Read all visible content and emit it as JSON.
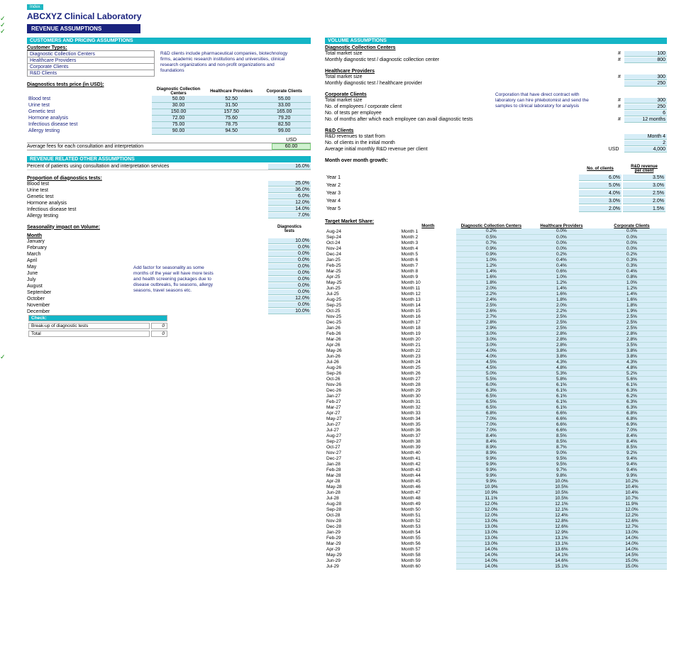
{
  "indexLabel": "Index",
  "title": "ABCXYZ Clinical Laboratory",
  "sectionTitle": "REVENUE ASSUMPTIONS",
  "left": {
    "custPricingTitle": "CUSTOMERS AND PRICING ASSUMPTIONS",
    "customerTypesLabel": "Customer Types:",
    "customerTypes": [
      "Diagnostic Collection Centers",
      "Healthcare Providers",
      "Corporate Clients",
      "R&D Clients"
    ],
    "rdNote": "R&D clients include pharmaceutical companies, biotechnology firms, academic research institutions and universities, clinical research organizations and non-profit organizations and foundations",
    "diagPriceLabel": "Diagnostics tests price (in USD):",
    "priceCols": [
      "Diagnostic Collection Centers",
      "Healthcare Providers",
      "Corporate Clients"
    ],
    "priceRows": [
      {
        "n": "Blood test",
        "v": [
          "50.00",
          "52.50",
          "55.00"
        ]
      },
      {
        "n": "Urine test",
        "v": [
          "30.00",
          "31.50",
          "33.00"
        ]
      },
      {
        "n": "Genetic test",
        "v": [
          "150.00",
          "157.50",
          "165.00"
        ]
      },
      {
        "n": "Hormone analysis",
        "v": [
          "72.00",
          "75.60",
          "79.20"
        ]
      },
      {
        "n": "Infectious disease test",
        "v": [
          "75.00",
          "78.75",
          "82.50"
        ]
      },
      {
        "n": "Allergy testing",
        "v": [
          "90.00",
          "94.50",
          "99.00"
        ]
      }
    ],
    "usdLabel": "USD",
    "avgFeesLabel": "Average fees for each consultation and interpretation",
    "avgFees": "60.00",
    "revOtherTitle": "REVENUE RELATED OTHER ASSUMPTIONS",
    "pctConsultLabel": "Percent of patients using consultation and interpretation services",
    "pctConsult": "16.0%",
    "propLabel": "Proportion of diagnostics tests:",
    "propRows": [
      {
        "n": "Blood test",
        "v": "25.0%"
      },
      {
        "n": "Urine test",
        "v": "36.0%"
      },
      {
        "n": "Genetic test",
        "v": "6.0%"
      },
      {
        "n": "Hormone analysis",
        "v": "12.0%"
      },
      {
        "n": "Infectious disease test",
        "v": "14.0%"
      },
      {
        "n": "Allergy testing",
        "v": "7.0%"
      }
    ],
    "seasonLabel": "Seasonality impact on Volume:",
    "seasonMonthHdr": "Month",
    "seasonTestsHdr": "Diagnostics\ntests",
    "seasonNote": "Add factor for seasonality as some months of the year will have more tests and health screening packages due to disease outbreaks, flu seasons, allergy seasons, travel seasons etc.",
    "seasonRows": [
      {
        "m": "January",
        "v": "10.0%"
      },
      {
        "m": "February",
        "v": "0.0%"
      },
      {
        "m": "March",
        "v": "0.0%"
      },
      {
        "m": "April",
        "v": "0.0%"
      },
      {
        "m": "May",
        "v": "0.0%"
      },
      {
        "m": "June",
        "v": "0.0%"
      },
      {
        "m": "July",
        "v": "0.0%"
      },
      {
        "m": "August",
        "v": "0.0%"
      },
      {
        "m": "September",
        "v": "0.0%"
      },
      {
        "m": "October",
        "v": "12.0%"
      },
      {
        "m": "November",
        "v": "0.0%"
      },
      {
        "m": "December",
        "v": "10.0%"
      }
    ],
    "checkTitle": "Check:",
    "checkRow1": "Break-up of diagnostic tests",
    "checkRow1v": "0",
    "checkRow2": "Total",
    "checkRow2v": "0"
  },
  "right": {
    "volTitle": "VOLUME ASSUMPTIONS",
    "dcc": {
      "title": "Diagnostic Collection Centers",
      "r1": "Total market size",
      "v1": "100",
      "r2": "Monthly diagnostic test / diagnostic collection center",
      "v2": "800"
    },
    "hp": {
      "title": "Healthcare Providers",
      "r1": "Total market size",
      "v1": "300",
      "r2": "Monthly diagnostic test / healthcare provider",
      "v2": "250"
    },
    "cc": {
      "title": "Corporate Clients",
      "note": "Corporation that have direct contract with laboratory can hire phlebotomist and send the samples to clinical laboratory for analysis",
      "r1": "Total market size",
      "v1": "300",
      "r2": "No. of employees / corporate client",
      "v2": "250",
      "r3": "No. of tests per employee",
      "v3": "6",
      "r4": "No. of months after which each employee can avail diagnostic tests",
      "v4": "12 months"
    },
    "rd": {
      "title": "R&D Clients",
      "r1": "R&D revenues to start from",
      "v1": "Month 4",
      "r2": "No. of clients in the initial month",
      "v2": "2",
      "r3": "Average initial monthly R&D revenue per client",
      "u3": "USD",
      "v3": "4,000"
    },
    "momTitle": "Month over month growth:",
    "momCol1": "No. of clients",
    "momCol2": "R&D revenue\nper client",
    "momRows": [
      {
        "y": "Year 1",
        "a": "6.0%",
        "b": "3.5%"
      },
      {
        "y": "Year 2",
        "a": "5.0%",
        "b": "3.0%"
      },
      {
        "y": "Year 3",
        "a": "4.0%",
        "b": "2.5%"
      },
      {
        "y": "Year 4",
        "a": "3.0%",
        "b": "2.0%"
      },
      {
        "y": "Year 5",
        "a": "2.0%",
        "b": "1.5%"
      }
    ],
    "tmsTitle": "Target Market Share:",
    "tmsMonthHdr": "Month",
    "tmsCols": [
      "Diagnostic Collection Centers",
      "Healthcare Providers",
      "Corporate Clients"
    ],
    "tmsRows": [
      {
        "d": "Aug-24",
        "m": "Month 1",
        "v": [
          "0.2%",
          "0.0%",
          "0.0%"
        ]
      },
      {
        "d": "Sep-24",
        "m": "Month 2",
        "v": [
          "0.5%",
          "0.0%",
          "0.0%"
        ]
      },
      {
        "d": "Oct-24",
        "m": "Month 3",
        "v": [
          "0.7%",
          "0.0%",
          "0.0%"
        ]
      },
      {
        "d": "Nov-24",
        "m": "Month 4",
        "v": [
          "0.9%",
          "0.0%",
          "0.0%"
        ]
      },
      {
        "d": "Dec-24",
        "m": "Month 5",
        "v": [
          "0.9%",
          "0.2%",
          "0.2%"
        ]
      },
      {
        "d": "Jan-25",
        "m": "Month 6",
        "v": [
          "1.0%",
          "0.4%",
          "0.3%"
        ]
      },
      {
        "d": "Feb-25",
        "m": "Month 7",
        "v": [
          "1.2%",
          "0.4%",
          "0.3%"
        ]
      },
      {
        "d": "Mar-25",
        "m": "Month 8",
        "v": [
          "1.4%",
          "0.6%",
          "0.4%"
        ]
      },
      {
        "d": "Apr-25",
        "m": "Month 9",
        "v": [
          "1.6%",
          "1.0%",
          "0.8%"
        ]
      },
      {
        "d": "May-25",
        "m": "Month 10",
        "v": [
          "1.8%",
          "1.2%",
          "1.0%"
        ]
      },
      {
        "d": "Jun-25",
        "m": "Month 11",
        "v": [
          "2.0%",
          "1.4%",
          "1.2%"
        ]
      },
      {
        "d": "Jul-25",
        "m": "Month 12",
        "v": [
          "2.2%",
          "1.6%",
          "1.4%"
        ]
      },
      {
        "d": "Aug-25",
        "m": "Month 13",
        "v": [
          "2.4%",
          "1.8%",
          "1.6%"
        ]
      },
      {
        "d": "Sep-25",
        "m": "Month 14",
        "v": [
          "2.5%",
          "2.0%",
          "1.8%"
        ]
      },
      {
        "d": "Oct-25",
        "m": "Month 15",
        "v": [
          "2.6%",
          "2.2%",
          "1.9%"
        ]
      },
      {
        "d": "Nov-25",
        "m": "Month 16",
        "v": [
          "2.7%",
          "2.5%",
          "2.5%"
        ]
      },
      {
        "d": "Dec-25",
        "m": "Month 17",
        "v": [
          "2.8%",
          "2.5%",
          "2.5%"
        ]
      },
      {
        "d": "Jan-26",
        "m": "Month 18",
        "v": [
          "2.9%",
          "2.5%",
          "2.5%"
        ]
      },
      {
        "d": "Feb-26",
        "m": "Month 19",
        "v": [
          "3.0%",
          "2.8%",
          "2.8%"
        ]
      },
      {
        "d": "Mar-26",
        "m": "Month 20",
        "v": [
          "3.0%",
          "2.8%",
          "2.8%"
        ]
      },
      {
        "d": "Apr-26",
        "m": "Month 21",
        "v": [
          "3.0%",
          "2.8%",
          "3.5%"
        ]
      },
      {
        "d": "May-26",
        "m": "Month 22",
        "v": [
          "4.0%",
          "3.8%",
          "3.8%"
        ]
      },
      {
        "d": "Jun-26",
        "m": "Month 23",
        "v": [
          "4.0%",
          "3.8%",
          "3.8%"
        ]
      },
      {
        "d": "Jul-26",
        "m": "Month 24",
        "v": [
          "4.5%",
          "4.3%",
          "4.3%"
        ]
      },
      {
        "d": "Aug-26",
        "m": "Month 25",
        "v": [
          "4.5%",
          "4.8%",
          "4.8%"
        ]
      },
      {
        "d": "Sep-26",
        "m": "Month 26",
        "v": [
          "5.0%",
          "5.3%",
          "5.2%"
        ]
      },
      {
        "d": "Oct-26",
        "m": "Month 27",
        "v": [
          "5.5%",
          "5.8%",
          "5.6%"
        ]
      },
      {
        "d": "Nov-26",
        "m": "Month 28",
        "v": [
          "6.0%",
          "6.1%",
          "6.1%"
        ]
      },
      {
        "d": "Dec-26",
        "m": "Month 29",
        "v": [
          "6.3%",
          "6.1%",
          "6.3%"
        ]
      },
      {
        "d": "Jan-27",
        "m": "Month 30",
        "v": [
          "6.5%",
          "6.1%",
          "6.2%"
        ]
      },
      {
        "d": "Feb-27",
        "m": "Month 31",
        "v": [
          "6.5%",
          "6.1%",
          "6.3%"
        ]
      },
      {
        "d": "Mar-27",
        "m": "Month 32",
        "v": [
          "6.5%",
          "6.1%",
          "6.3%"
        ]
      },
      {
        "d": "Apr-27",
        "m": "Month 33",
        "v": [
          "6.8%",
          "6.6%",
          "6.8%"
        ]
      },
      {
        "d": "May-27",
        "m": "Month 34",
        "v": [
          "7.0%",
          "6.6%",
          "6.8%"
        ]
      },
      {
        "d": "Jun-27",
        "m": "Month 35",
        "v": [
          "7.0%",
          "6.6%",
          "6.9%"
        ]
      },
      {
        "d": "Jul-27",
        "m": "Month 36",
        "v": [
          "7.0%",
          "6.6%",
          "7.0%"
        ]
      },
      {
        "d": "Aug-27",
        "m": "Month 37",
        "v": [
          "8.4%",
          "8.5%",
          "8.4%"
        ]
      },
      {
        "d": "Sep-27",
        "m": "Month 38",
        "v": [
          "8.4%",
          "8.5%",
          "8.4%"
        ]
      },
      {
        "d": "Oct-27",
        "m": "Month 39",
        "v": [
          "8.9%",
          "8.7%",
          "8.5%"
        ]
      },
      {
        "d": "Nov-27",
        "m": "Month 40",
        "v": [
          "8.9%",
          "9.0%",
          "9.2%"
        ]
      },
      {
        "d": "Dec-27",
        "m": "Month 41",
        "v": [
          "9.9%",
          "9.5%",
          "9.4%"
        ]
      },
      {
        "d": "Jan-28",
        "m": "Month 42",
        "v": [
          "9.9%",
          "9.5%",
          "9.4%"
        ]
      },
      {
        "d": "Feb-28",
        "m": "Month 43",
        "v": [
          "9.9%",
          "9.7%",
          "9.4%"
        ]
      },
      {
        "d": "Mar-28",
        "m": "Month 44",
        "v": [
          "9.9%",
          "9.8%",
          "9.9%"
        ]
      },
      {
        "d": "Apr-28",
        "m": "Month 45",
        "v": [
          "9.9%",
          "10.0%",
          "10.2%"
        ]
      },
      {
        "d": "May-28",
        "m": "Month 46",
        "v": [
          "10.9%",
          "10.5%",
          "10.4%"
        ]
      },
      {
        "d": "Jun-28",
        "m": "Month 47",
        "v": [
          "10.9%",
          "10.5%",
          "10.4%"
        ]
      },
      {
        "d": "Jul-28",
        "m": "Month 48",
        "v": [
          "11.1%",
          "10.5%",
          "10.7%"
        ]
      },
      {
        "d": "Aug-28",
        "m": "Month 49",
        "v": [
          "12.0%",
          "12.1%",
          "11.9%"
        ]
      },
      {
        "d": "Sep-28",
        "m": "Month 50",
        "v": [
          "12.0%",
          "12.1%",
          "12.0%"
        ]
      },
      {
        "d": "Oct-28",
        "m": "Month 51",
        "v": [
          "12.0%",
          "12.4%",
          "12.2%"
        ]
      },
      {
        "d": "Nov-28",
        "m": "Month 52",
        "v": [
          "13.0%",
          "12.8%",
          "12.6%"
        ]
      },
      {
        "d": "Dec-28",
        "m": "Month 53",
        "v": [
          "13.0%",
          "12.6%",
          "12.7%"
        ]
      },
      {
        "d": "Jan-29",
        "m": "Month 54",
        "v": [
          "13.0%",
          "12.9%",
          "13.0%"
        ]
      },
      {
        "d": "Feb-29",
        "m": "Month 55",
        "v": [
          "13.0%",
          "13.1%",
          "14.0%"
        ]
      },
      {
        "d": "Mar-29",
        "m": "Month 56",
        "v": [
          "13.0%",
          "13.1%",
          "14.0%"
        ]
      },
      {
        "d": "Apr-29",
        "m": "Month 57",
        "v": [
          "14.0%",
          "13.6%",
          "14.0%"
        ]
      },
      {
        "d": "May-29",
        "m": "Month 58",
        "v": [
          "14.0%",
          "14.1%",
          "14.5%"
        ]
      },
      {
        "d": "Jun-29",
        "m": "Month 59",
        "v": [
          "14.0%",
          "14.6%",
          "15.0%"
        ]
      },
      {
        "d": "Jul-29",
        "m": "Month 60",
        "v": [
          "14.0%",
          "15.1%",
          "15.0%"
        ]
      }
    ]
  }
}
